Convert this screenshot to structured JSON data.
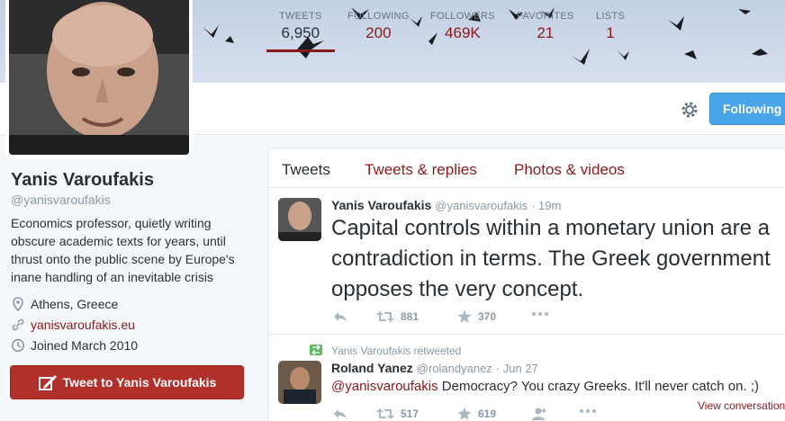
{
  "profile": {
    "name": "Yanis Varoufakis",
    "handle": "@yanisvaroufakis",
    "bio": "Economics professor, quietly writing obscure academic texts for years, until thrust onto the public scene by Europe's inane handling of an inevitable crisis",
    "location": "Athens, Greece",
    "website": "yanisvaroufakis.eu",
    "joined": "Joined March 2010",
    "tweet_to_label": "Tweet to Yanis Varoufakis"
  },
  "stats": [
    {
      "label": "TWEETS",
      "value": "6,950"
    },
    {
      "label": "FOLLOWING",
      "value": "200"
    },
    {
      "label": "FOLLOWERS",
      "value": "469K"
    },
    {
      "label": "FAVORITES",
      "value": "21"
    },
    {
      "label": "LISTS",
      "value": "1"
    }
  ],
  "follow_button": "Following",
  "tabs": [
    "Tweets",
    "Tweets & replies",
    "Photos & videos"
  ],
  "tweets": [
    {
      "author": "Yanis Varoufakis",
      "handle": "@yanisvaroufakis",
      "time": "· 19m",
      "text": "Capital controls within a monetary union are a contradiction in terms. The Greek government opposes the very concept.",
      "retweets": "881",
      "favorites": "370"
    },
    {
      "retweeted_by": "Yanis Varoufakis retweeted",
      "author": "Roland Yanez",
      "handle": "@rolandyanez",
      "time": "· Jun 27",
      "mention": "@yanisvaroufakis",
      "text": " Democracy? You crazy Greeks. It'll never catch on. ;)",
      "retweets": "517",
      "favorites": "619",
      "view_conversation": "View conversation"
    }
  ],
  "colors": {
    "link": "#8b1a1a",
    "follow": "#4aa4e8",
    "tweet_to": "#b2302b"
  }
}
